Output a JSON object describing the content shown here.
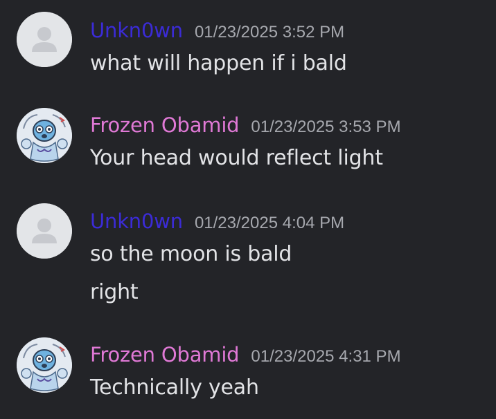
{
  "messages": [
    {
      "username": "Unkn0wn",
      "username_color": "#3b2bd6",
      "timestamp": "01/23/2025 3:52 PM",
      "avatar": "default-user-avatar-icon",
      "lines": [
        "what will happen if i bald"
      ]
    },
    {
      "username": "Frozen Obamid",
      "username_color": "#e079d6",
      "timestamp": "01/23/2025 3:53 PM",
      "avatar": "cartoon-character-avatar",
      "lines": [
        "Your head would reflect light"
      ]
    },
    {
      "username": "Unkn0wn",
      "username_color": "#3b2bd6",
      "timestamp": "01/23/2025 4:04 PM",
      "avatar": "default-user-avatar-icon",
      "lines": [
        "so the moon is bald",
        "right"
      ]
    },
    {
      "username": "Frozen Obamid",
      "username_color": "#e079d6",
      "timestamp": "01/23/2025 4:31 PM",
      "avatar": "cartoon-character-avatar",
      "lines": [
        "Technically yeah"
      ]
    }
  ]
}
